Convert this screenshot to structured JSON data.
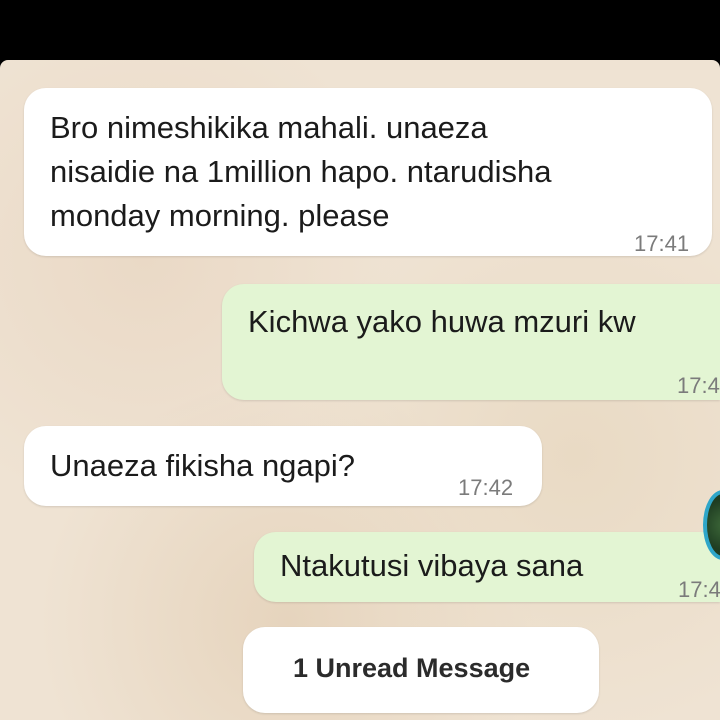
{
  "messages": [
    {
      "direction": "incoming",
      "lines": [
        "Bro nimeshikika mahali. unaeza",
        "nisaidie na 1million hapo. ntarudisha",
        "monday morning. please"
      ],
      "time": "17:41"
    },
    {
      "direction": "outgoing",
      "lines": [
        "Kichwa yako huwa mzuri kw"
      ],
      "time": "17:4"
    },
    {
      "direction": "incoming",
      "lines": [
        "Unaeza fikisha ngapi?"
      ],
      "time": "17:42"
    },
    {
      "direction": "outgoing",
      "lines": [
        "Ntakutusi vibaya sana"
      ],
      "time": "17:4"
    }
  ],
  "unread_banner": {
    "label": "1 Unread Message"
  },
  "colors": {
    "top_bar": "#000000",
    "chat_background": "#efe3d3",
    "incoming_bubble": "#ffffff",
    "outgoing_bubble": "#e3f5d3",
    "timestamp": "#7b7b7b",
    "avatar_ring": "#2ea6c9"
  },
  "icons": {
    "avatar": "contact-avatar"
  }
}
